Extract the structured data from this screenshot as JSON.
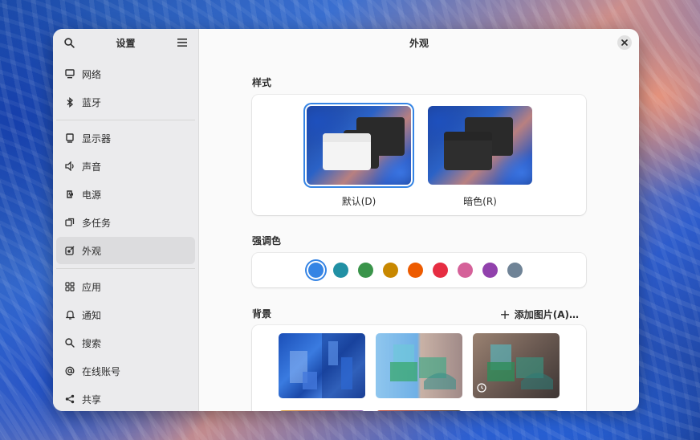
{
  "sidebar": {
    "title": "设置",
    "search_icon": "search-icon",
    "menu_icon": "hamburger-menu-icon",
    "items": [
      {
        "label": "网络",
        "icon": "network-icon"
      },
      {
        "label": "蓝牙",
        "icon": "bluetooth-icon"
      },
      {
        "label": "显示器",
        "icon": "display-icon"
      },
      {
        "label": "声音",
        "icon": "sound-icon"
      },
      {
        "label": "电源",
        "icon": "power-icon"
      },
      {
        "label": "多任务",
        "icon": "multitasking-icon"
      },
      {
        "label": "外观",
        "icon": "appearance-icon"
      },
      {
        "label": "应用",
        "icon": "apps-icon"
      },
      {
        "label": "通知",
        "icon": "bell-icon"
      },
      {
        "label": "搜索",
        "icon": "search-icon"
      },
      {
        "label": "在线账号",
        "icon": "at-icon"
      },
      {
        "label": "共享",
        "icon": "share-icon"
      }
    ],
    "active": "外观"
  },
  "header": {
    "title": "外观",
    "close_icon": "close-icon"
  },
  "style_section": {
    "label": "样式",
    "options": [
      {
        "label": "默认(D)",
        "selected": true
      },
      {
        "label": "暗色(R)",
        "selected": false
      }
    ]
  },
  "accent_section": {
    "label": "强调色",
    "colors": [
      "#3584e4",
      "#2190a4",
      "#3a944a",
      "#c88800",
      "#ed5b00",
      "#e62d42",
      "#d56199",
      "#9141ac",
      "#6f8396"
    ],
    "selected": "#3584e4"
  },
  "background_section": {
    "label": "背景",
    "add_button": "添加图片(A)…"
  },
  "colors": {
    "accent": "#3584e4",
    "sidebar_bg": "#ebebed",
    "window_bg": "#fafafa"
  }
}
